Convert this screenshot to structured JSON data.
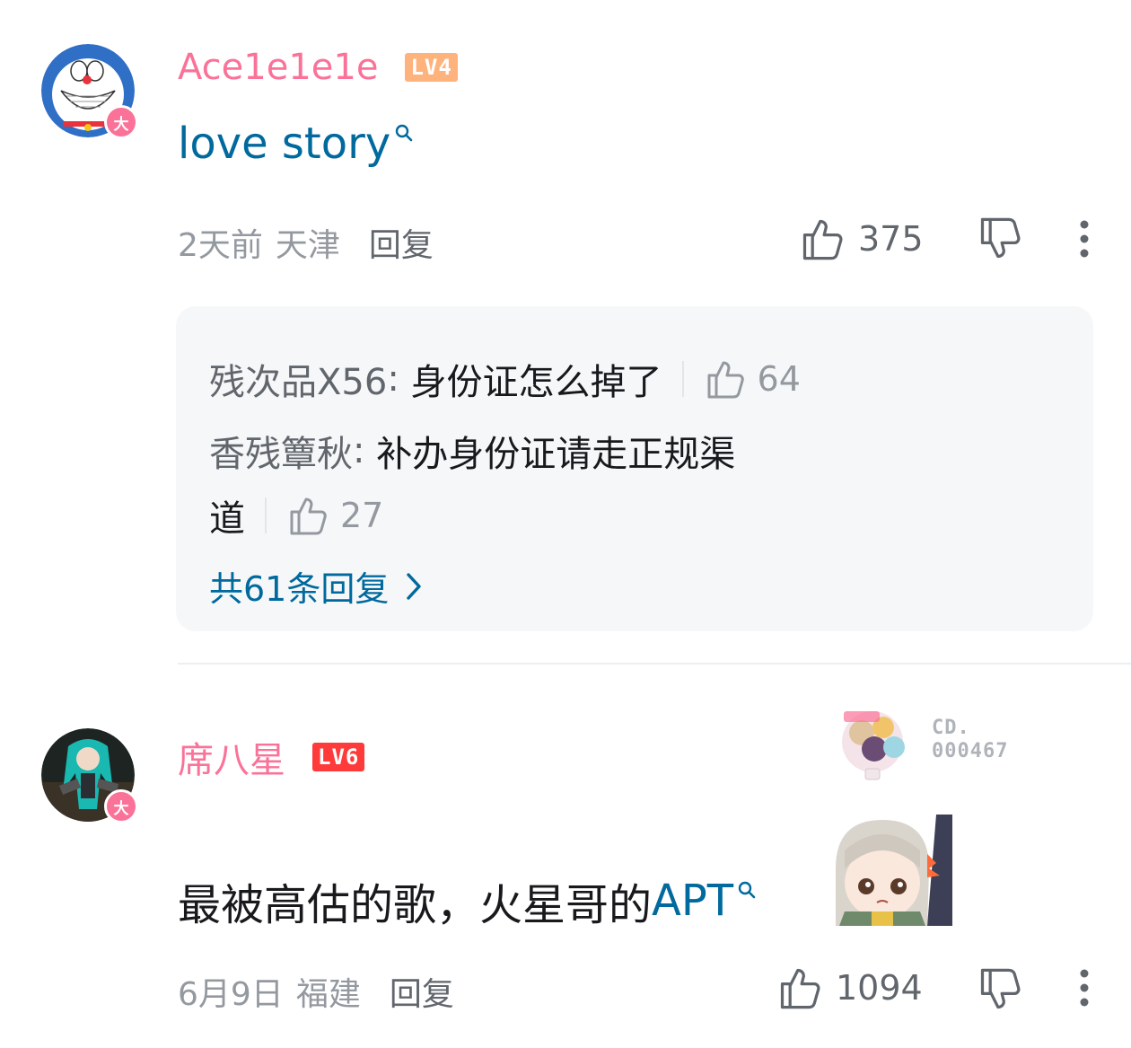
{
  "comments": [
    {
      "username": "Ace1e1e1e",
      "level": "LV4",
      "vip_badge": "大",
      "content_link": "love story",
      "time": "2天前",
      "location": "天津",
      "reply_label": "回复",
      "likes": "375",
      "replies": [
        {
          "name": "残次品X56",
          "text": "身份证怎么掉了",
          "likes": "64"
        },
        {
          "name": "香残簟秋",
          "text": "补办身份证请走正规渠",
          "text_cont": "道",
          "likes": "27"
        }
      ],
      "more_replies": "共61条回复"
    },
    {
      "username": "席八星",
      "level": "LV6",
      "vip_badge": "大",
      "fan_badge_no_line1": "CD.",
      "fan_badge_no_line2": "000467",
      "content_text": "最被高估的歌，火星哥的",
      "content_link": "APT",
      "time": "6月9日",
      "location": "福建",
      "reply_label": "回复",
      "likes": "1094"
    }
  ],
  "colors": {
    "username": "#fb7299",
    "link": "#00699d",
    "meta": "#9499a0",
    "reply_bg": "#f6f7f8"
  }
}
